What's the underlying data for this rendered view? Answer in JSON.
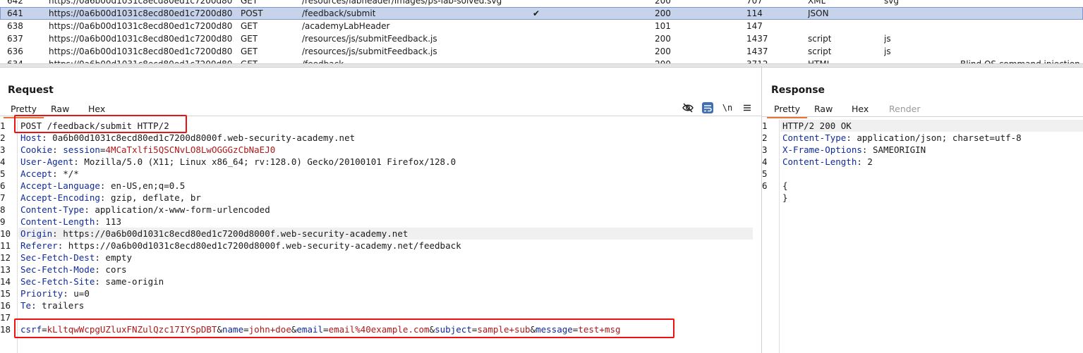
{
  "history": [
    {
      "num": "642",
      "host": "https://0a6b00d1031c8ecd80ed1c7200d80…",
      "method": "GET",
      "url": "/resources/labheader/images/ps-lab-solved.svg",
      "edited": "",
      "status": "200",
      "length": "707",
      "mime": "XML",
      "ext": "svg",
      "title": "",
      "selected": false
    },
    {
      "num": "641",
      "host": "https://0a6b00d1031c8ecd80ed1c7200d80…",
      "method": "POST",
      "url": "/feedback/submit",
      "edited": "✔",
      "status": "200",
      "length": "114",
      "mime": "JSON",
      "ext": "",
      "title": "",
      "selected": true
    },
    {
      "num": "638",
      "host": "https://0a6b00d1031c8ecd80ed1c7200d80…",
      "method": "GET",
      "url": "/academyLabHeader",
      "edited": "",
      "status": "101",
      "length": "147",
      "mime": "",
      "ext": "",
      "title": "",
      "selected": false
    },
    {
      "num": "637",
      "host": "https://0a6b00d1031c8ecd80ed1c7200d80…",
      "method": "GET",
      "url": "/resources/js/submitFeedback.js",
      "edited": "",
      "status": "200",
      "length": "1437",
      "mime": "script",
      "ext": "js",
      "title": "",
      "selected": false
    },
    {
      "num": "636",
      "host": "https://0a6b00d1031c8ecd80ed1c7200d80…",
      "method": "GET",
      "url": "/resources/js/submitFeedback.js",
      "edited": "",
      "status": "200",
      "length": "1437",
      "mime": "script",
      "ext": "js",
      "title": "",
      "selected": false
    },
    {
      "num": "634",
      "host": "https://0a6b00d1031c8ecd80ed1c7200d80…",
      "method": "GET",
      "url": "/feedback",
      "edited": "",
      "status": "200",
      "length": "3712",
      "mime": "HTML",
      "ext": "",
      "title": "Blind OS command injection w",
      "selected": false
    }
  ],
  "request": {
    "title": "Request",
    "tabs": [
      "Pretty",
      "Raw",
      "Hex"
    ],
    "lines": [
      {
        "n": "1",
        "k": "",
        "v": "POST /feedback/submit HTTP/2",
        "red": false
      },
      {
        "n": "2",
        "k": "Host",
        "v": "0a6b00d1031c8ecd80ed1c7200d8000f.web-security-academy.net",
        "red": false
      },
      {
        "n": "3",
        "k": "Cookie",
        "v": "",
        "ck": "session",
        "cv": "4MCaTxlfi5QSCNvLO8LwOGGGzCbNaEJ0",
        "red": false
      },
      {
        "n": "4",
        "k": "User-Agent",
        "v": "Mozilla/5.0 (X11; Linux x86_64; rv:128.0) Gecko/20100101 Firefox/128.0",
        "red": false
      },
      {
        "n": "5",
        "k": "Accept",
        "v": "*/*",
        "red": false
      },
      {
        "n": "6",
        "k": "Accept-Language",
        "v": "en-US,en;q=0.5",
        "red": false
      },
      {
        "n": "7",
        "k": "Accept-Encoding",
        "v": "gzip, deflate, br",
        "red": false
      },
      {
        "n": "8",
        "k": "Content-Type",
        "v": "application/x-www-form-urlencoded",
        "red": false
      },
      {
        "n": "9",
        "k": "Content-Length",
        "v": "113",
        "red": false
      },
      {
        "n": "10",
        "k": "Origin",
        "v": "https://0a6b00d1031c8ecd80ed1c7200d8000f.web-security-academy.net",
        "red": false
      },
      {
        "n": "11",
        "k": "Referer",
        "v": "https://0a6b00d1031c8ecd80ed1c7200d8000f.web-security-academy.net/feedback",
        "red": false
      },
      {
        "n": "12",
        "k": "Sec-Fetch-Dest",
        "v": "empty",
        "red": false
      },
      {
        "n": "13",
        "k": "Sec-Fetch-Mode",
        "v": "cors",
        "red": false
      },
      {
        "n": "14",
        "k": "Sec-Fetch-Site",
        "v": "same-origin",
        "red": false
      },
      {
        "n": "15",
        "k": "Priority",
        "v": "u=0",
        "red": false
      },
      {
        "n": "16",
        "k": "Te",
        "v": "trailers",
        "red": false
      },
      {
        "n": "17",
        "k": "",
        "v": "",
        "red": false
      },
      {
        "n": "18",
        "body": true
      }
    ],
    "body_params": [
      {
        "k": "csrf",
        "v": "kLltqwWcpgUZluxFNZulQzc17IYSpDBT"
      },
      {
        "k": "name",
        "v": "john+doe"
      },
      {
        "k": "email",
        "v": "email%40example.com"
      },
      {
        "k": "subject",
        "v": "sample+sub"
      },
      {
        "k": "message",
        "v": "test+msg"
      }
    ]
  },
  "response": {
    "title": "Response",
    "tabs": [
      "Pretty",
      "Raw",
      "Hex",
      "Render"
    ],
    "lines": [
      {
        "n": "1",
        "k": "",
        "v": "HTTP/2 200 OK"
      },
      {
        "n": "2",
        "k": "Content-Type",
        "v": "application/json; charset=utf-8"
      },
      {
        "n": "3",
        "k": "X-Frame-Options",
        "v": "SAMEORIGIN"
      },
      {
        "n": "4",
        "k": "Content-Length",
        "v": "2"
      },
      {
        "n": "5",
        "k": "",
        "v": ""
      },
      {
        "n": "6",
        "k": "",
        "v": "{"
      },
      {
        "n": "",
        "k": "",
        "v": "}"
      }
    ]
  },
  "toolbar": {
    "hide_icon": "eye-slash-icon",
    "wrap_icon": "word-wrap-icon",
    "newline_label": "\\n",
    "menu_icon": "hamburger-menu-icon",
    "accent": "#3f6fb5"
  }
}
